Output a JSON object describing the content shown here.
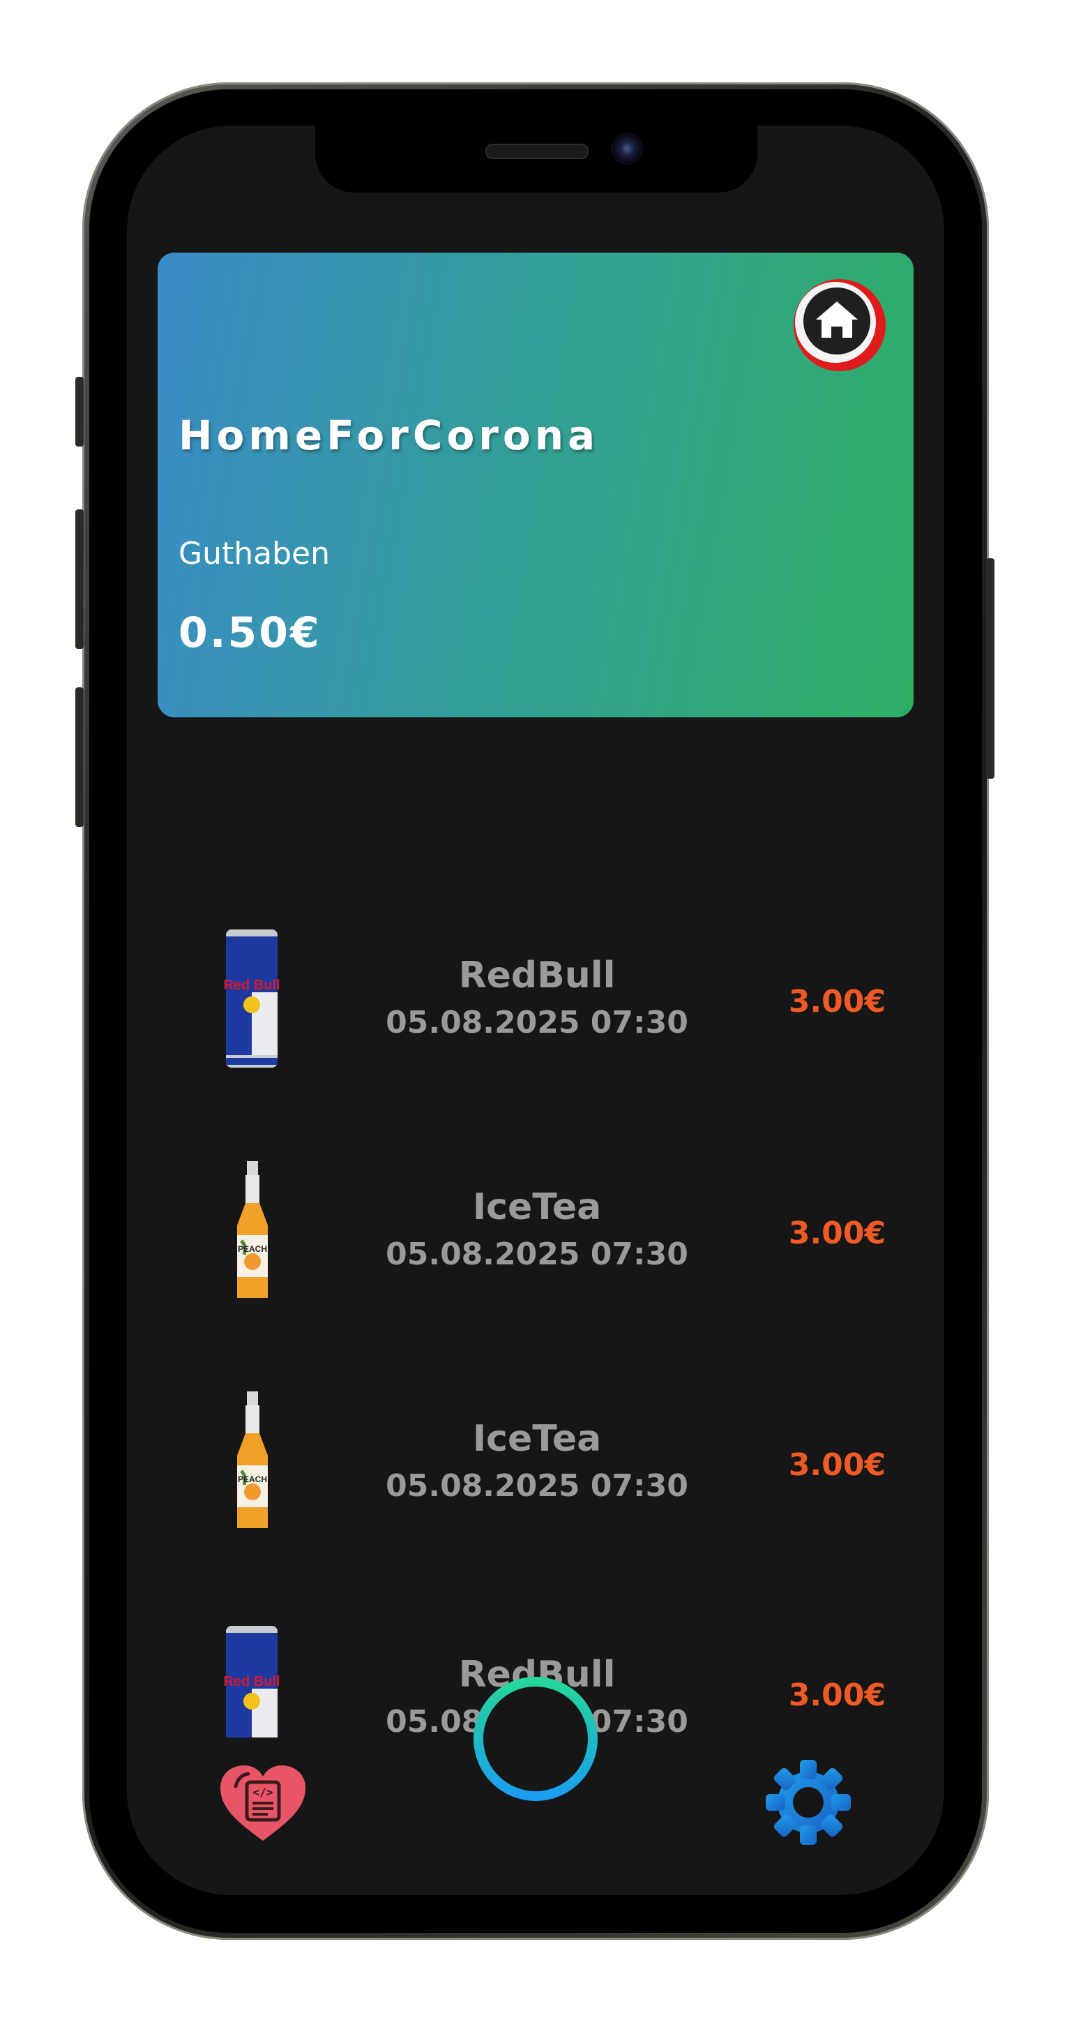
{
  "card": {
    "title": "HomeForCorona",
    "balance_label": "Guthaben",
    "balance_value": "0.50€"
  },
  "transactions": [
    {
      "name": "RedBull",
      "datetime": "05.08.2025 07:30",
      "price": "3.00€",
      "image": "redbull-can"
    },
    {
      "name": "IceTea",
      "datetime": "05.08.2025 07:30",
      "price": "3.00€",
      "image": "icetea-bottle"
    },
    {
      "name": "IceTea",
      "datetime": "05.08.2025 07:30",
      "price": "3.00€",
      "image": "icetea-bottle"
    },
    {
      "name": "RedBull",
      "datetime": "05.08.2025 07:30",
      "price": "3.00€",
      "image": "redbull-can"
    }
  ],
  "nav": {
    "left_icon": "heart-code-icon",
    "center_icon": "add-icon",
    "right_icon": "gear-icon"
  },
  "colors": {
    "background": "#161616",
    "card_gradient_start": "#3a8bc7",
    "card_gradient_end": "#2daf64",
    "price": "#f05a26",
    "text_muted": "#9a9a9a"
  }
}
